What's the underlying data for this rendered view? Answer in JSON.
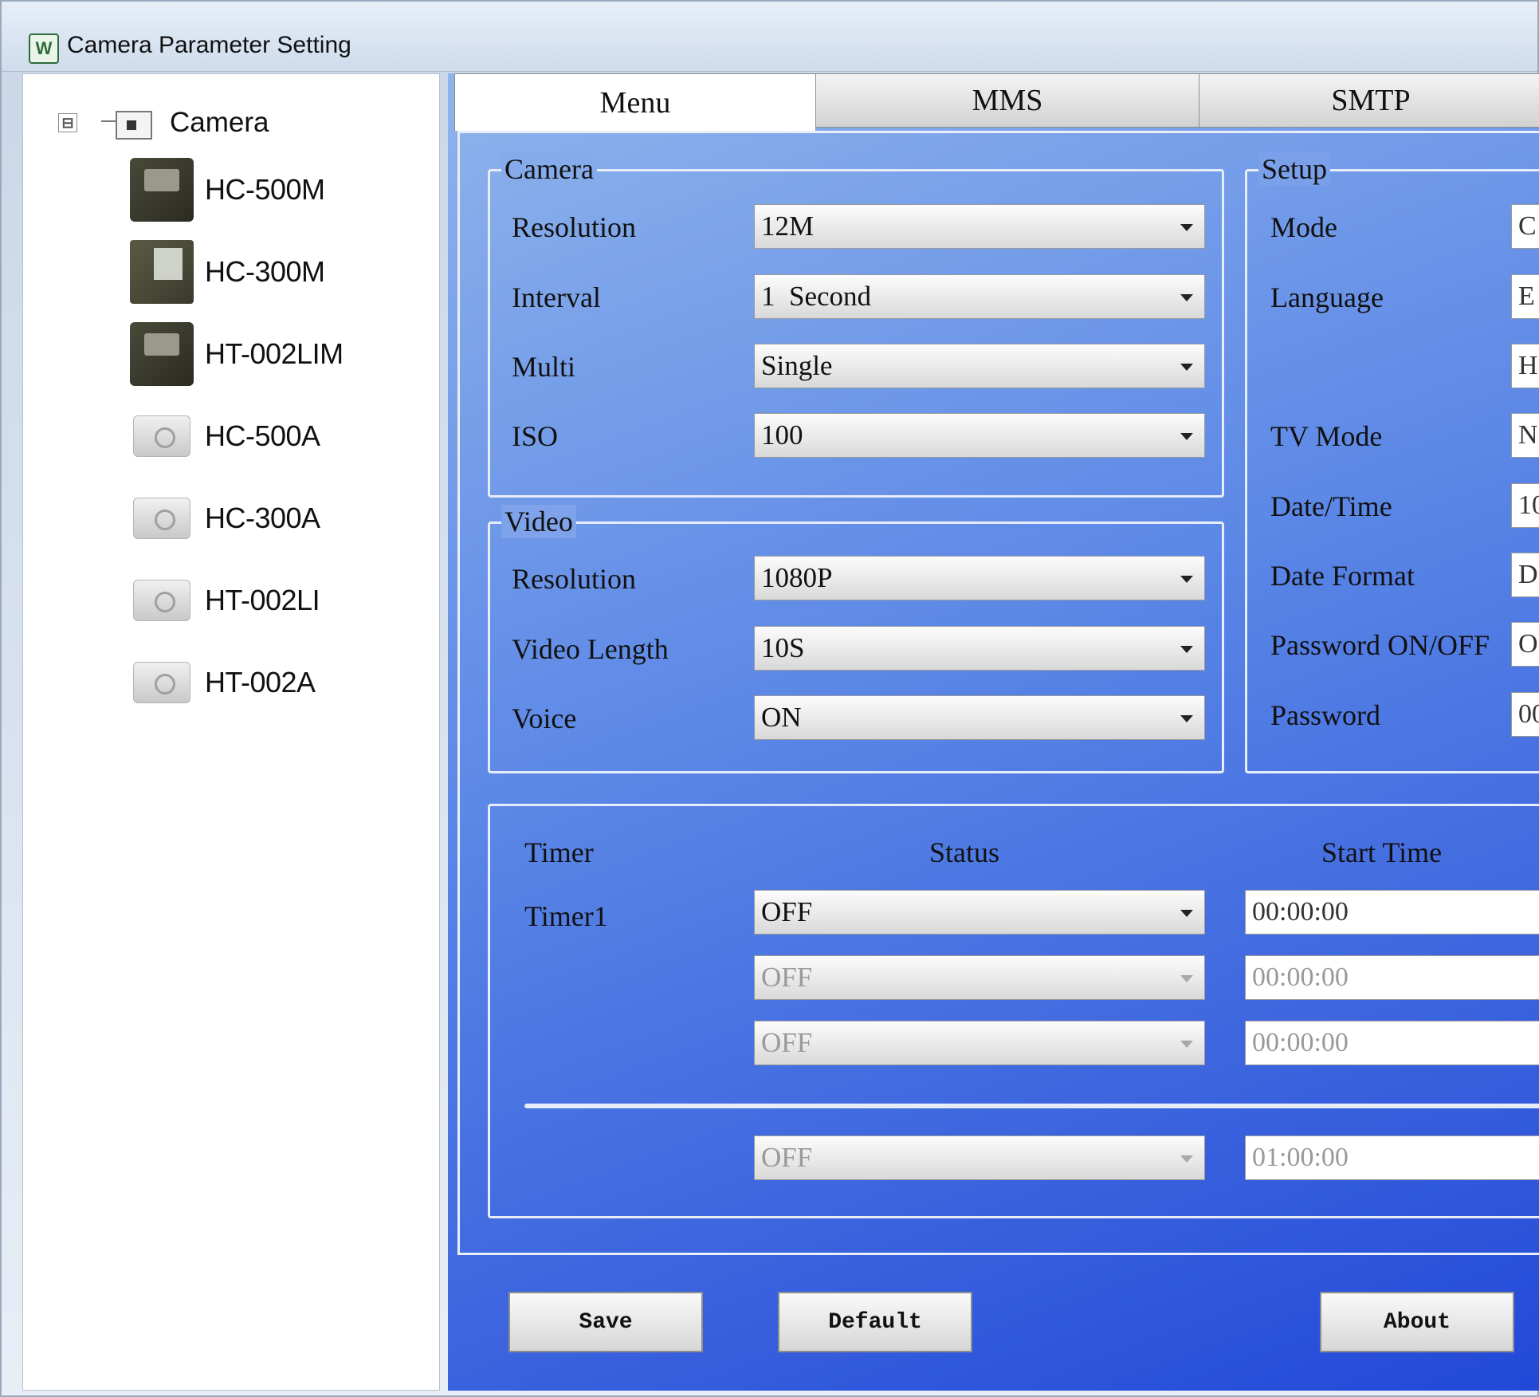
{
  "window": {
    "title": "Camera Parameter Setting",
    "icon_glyph": "W"
  },
  "tree": {
    "root": {
      "expander": "⊟",
      "label": "Camera"
    },
    "items": [
      {
        "label": "HC-500M",
        "icon": "photo"
      },
      {
        "label": "HC-300M",
        "icon": "photo2"
      },
      {
        "label": "HT-002LIM",
        "icon": "photo"
      },
      {
        "label": "HC-500A",
        "icon": "gray"
      },
      {
        "label": "HC-300A",
        "icon": "gray"
      },
      {
        "label": "HT-002LI",
        "icon": "gray"
      },
      {
        "label": "HT-002A",
        "icon": "gray"
      }
    ]
  },
  "tabs": [
    {
      "label": "Menu"
    },
    {
      "label": "MMS"
    },
    {
      "label": "SMTP"
    }
  ],
  "camera_group": {
    "legend": "Camera",
    "rows": [
      {
        "label": "Resolution",
        "value": "12M"
      },
      {
        "label": "Interval",
        "value": "1  Second"
      },
      {
        "label": "Multi",
        "value": "Single"
      },
      {
        "label": "ISO",
        "value": "100"
      }
    ]
  },
  "video_group": {
    "legend": "Video",
    "rows": [
      {
        "label": "Resolution",
        "value": "1080P"
      },
      {
        "label": "Video Length",
        "value": "10S"
      },
      {
        "label": "Voice",
        "value": "ON"
      }
    ]
  },
  "setup_group": {
    "legend": "Setup",
    "rows": [
      {
        "label": "Mode",
        "value": "C"
      },
      {
        "label": "Language",
        "value": "E"
      },
      {
        "label": "",
        "value": "H"
      },
      {
        "label": "TV Mode",
        "value": "N"
      },
      {
        "label": "Date/Time",
        "value": "10"
      },
      {
        "label": "Date Format",
        "value": "D"
      },
      {
        "label": "Password ON/OFF",
        "value": "O"
      },
      {
        "label": "Password",
        "value": "00"
      }
    ]
  },
  "timer_group": {
    "headers": {
      "timer": "Timer",
      "status": "Status",
      "start": "Start Time"
    },
    "rows": [
      {
        "label": "Timer1",
        "status": "OFF",
        "start": "00:00:00"
      },
      {
        "label": "",
        "status": "OFF",
        "start": "00:00:00"
      },
      {
        "label": "",
        "status": "OFF",
        "start": "00:00:00"
      }
    ],
    "lapse": {
      "label": "",
      "status": "OFF",
      "start": "01:00:00"
    }
  },
  "buttons": {
    "save": "Save",
    "default": "Default",
    "about": "About"
  }
}
